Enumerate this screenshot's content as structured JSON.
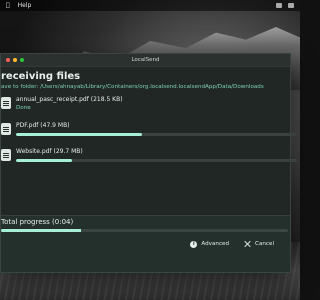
{
  "menubar": {
    "app_label": "",
    "help_label": "Help"
  },
  "window": {
    "title": "LocalSend",
    "heading": "receiving files",
    "save_prefix": "ave to folder: ",
    "save_path": "/Users/ahnayab/Library/Containers/org.localsend.localsendApp/Data/Downloads"
  },
  "files": [
    {
      "name": "annual_pasc_receipt.pdf",
      "size": "(218.5 KB)",
      "status": "Done",
      "progress": 1.0
    },
    {
      "name": "PDF.pdf",
      "size": "(47.9 MB)",
      "status": "",
      "progress": 0.45
    },
    {
      "name": "Website.pdf",
      "size": "(29.7 MB)",
      "status": "",
      "progress": 0.2
    }
  ],
  "total": {
    "label": "Total progress",
    "time": "(0:04)",
    "progress": 0.28
  },
  "actions": {
    "advanced": "Advanced",
    "cancel": "Cancel"
  },
  "colors": {
    "accent": "#a8f0d5",
    "accent_text": "#7ed1b3"
  }
}
